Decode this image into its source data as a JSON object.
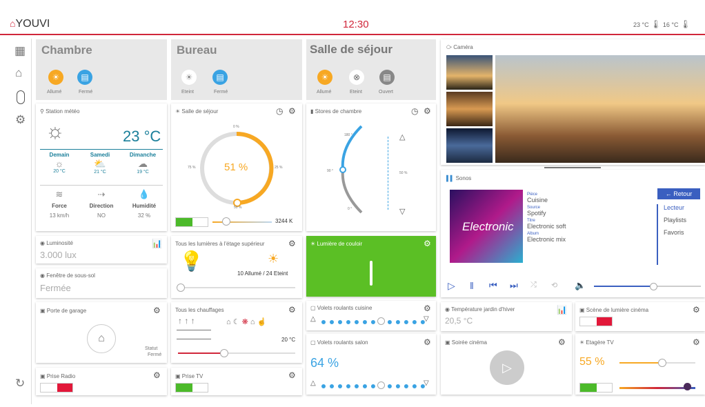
{
  "header": {
    "logo": "YOUVI",
    "clock": "12:30",
    "temp_inside": "23 °C",
    "temp_outside": "16 °C",
    "accent": "#d0263a"
  },
  "nav": {
    "icons": [
      "grid-icon",
      "house-icon",
      "remote-icon",
      "gear-icon",
      "refresh-icon"
    ]
  },
  "rooms": [
    {
      "name": "Chambre",
      "devices": [
        {
          "label": "Allumé",
          "icon": "bulb-icon"
        },
        {
          "label": "Fermé",
          "icon": "shutter-icon"
        }
      ]
    },
    {
      "name": "Bureau",
      "devices": [
        {
          "label": "Eteint",
          "icon": "bulb-icon"
        },
        {
          "label": "Fermé",
          "icon": "shutter-icon"
        }
      ]
    },
    {
      "name": "Salle de séjour",
      "devices": [
        {
          "label": "Allumé",
          "icon": "bulb-icon"
        },
        {
          "label": "Eteint",
          "icon": "appliance-icon"
        },
        {
          "label": "Ouvert",
          "icon": "shutter-icon"
        }
      ]
    }
  ],
  "weather": {
    "title": "Station météo",
    "temp": "23 °C",
    "days": [
      {
        "name": "Demain",
        "temp": "20 °C"
      },
      {
        "name": "Samedi",
        "temp": "21 °C"
      },
      {
        "name": "Dimanche",
        "temp": "19 °C"
      }
    ],
    "stats": [
      {
        "label": "Force",
        "value": "13 km/h"
      },
      {
        "label": "Direction",
        "value": "NO"
      },
      {
        "label": "Humidité",
        "value": "32 %"
      }
    ]
  },
  "sejour_light": {
    "title": "Salle de séjour",
    "value": "51 %",
    "ticks": [
      "0 %",
      "75 %",
      "25 %",
      "50 %"
    ],
    "level": 0.51,
    "kelvin": "3244 K"
  },
  "stores": {
    "title": "Stores de chambre",
    "angles": [
      "180 °",
      "90 °",
      "0 °"
    ],
    "pos": "50 %"
  },
  "camera": {
    "title": "Caméra"
  },
  "sonos": {
    "title": "Sonos",
    "retour": "Retour",
    "fields": [
      {
        "k": "Pièce",
        "v": "Cuisine"
      },
      {
        "k": "Source",
        "v": "Spotify"
      },
      {
        "k": "Titre",
        "v": "Electronic soft"
      },
      {
        "k": "Album",
        "v": "Electronic mix"
      }
    ],
    "menu": [
      "Lecteur",
      "Playlists",
      "Favoris"
    ],
    "album_text": "Electronic",
    "volume": 0.55
  },
  "luminosite": {
    "title": "Luminosité",
    "value": "3.000 lux"
  },
  "fenetre": {
    "title": "Fenêtre de sous-sol",
    "value": "Fermée"
  },
  "etage": {
    "title": "Tous les lumières à l'étage supérieur",
    "status": "10 Allumé / 24 Eteint"
  },
  "couloir": {
    "title": "Lumière de couloir"
  },
  "garage": {
    "title": "Porte de garage",
    "statut": "Statut",
    "state": "Fermé"
  },
  "chauffages": {
    "title": "Tous les chauffages",
    "temp": "20 °C"
  },
  "volets_cuisine": {
    "title": "Volets roulants cuisine"
  },
  "volets_salon": {
    "title": "Volets roulants salon",
    "value": "64 %"
  },
  "temp_jardin": {
    "title": "Température jardin d'hiver",
    "value": "20,5 °C"
  },
  "scene": {
    "title": "Scène de lumière cinéma"
  },
  "soiree": {
    "title": "Soirée cinéma"
  },
  "etagere": {
    "title": "Etagère TV",
    "value": "55 %"
  },
  "prise_radio": {
    "title": "Prise Radio"
  },
  "prise_tv": {
    "title": "Prise TV"
  }
}
